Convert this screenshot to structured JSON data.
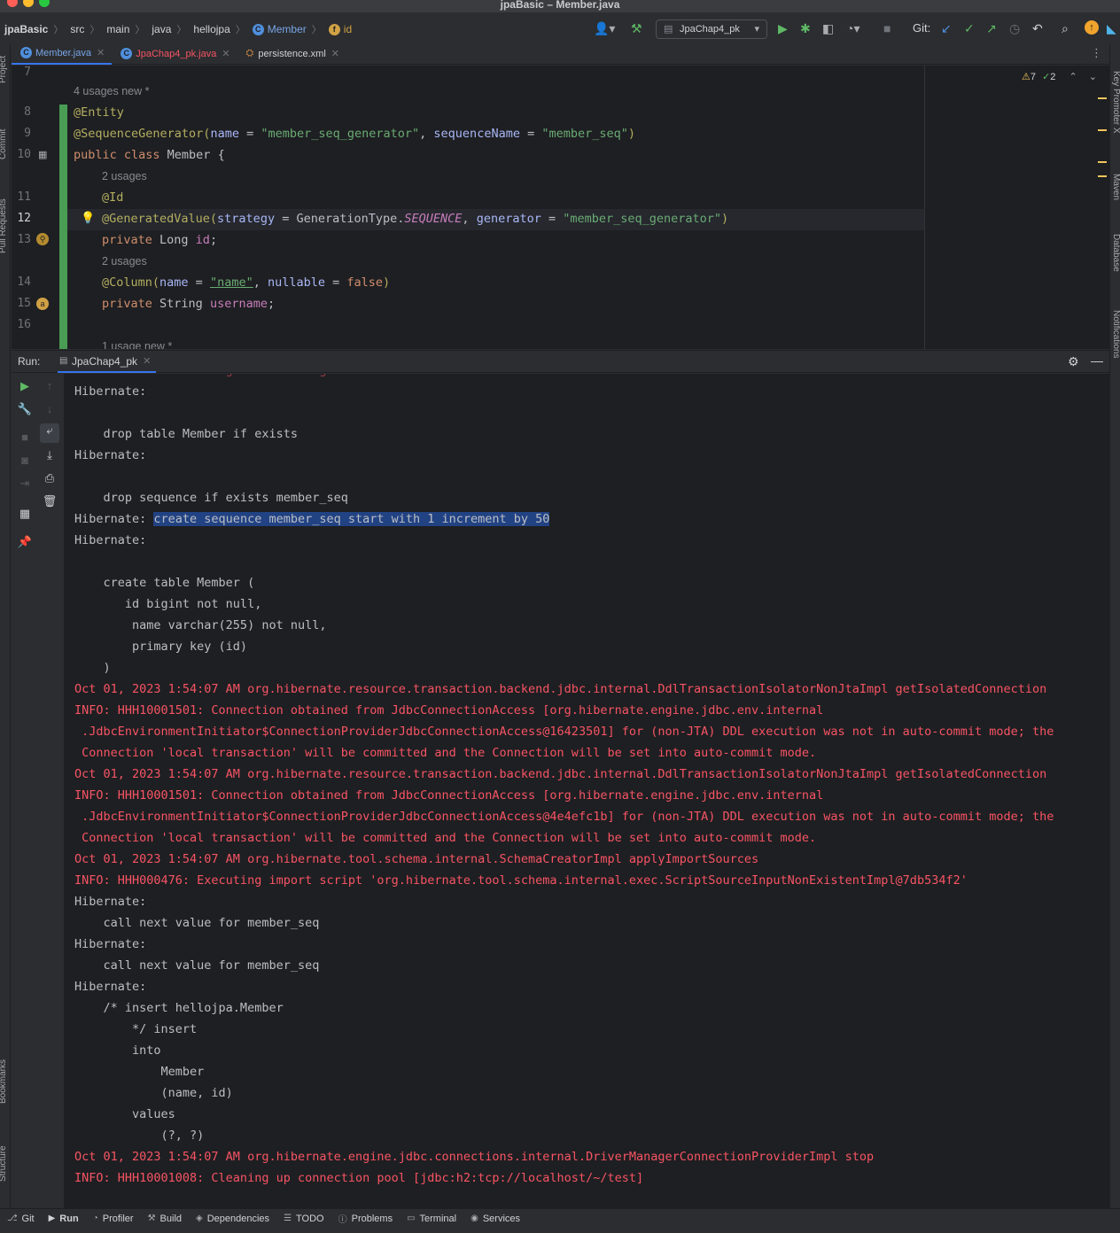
{
  "window": {
    "title": "jpaBasic – Member.java"
  },
  "breadcrumbs": [
    "jpaBasic",
    "src",
    "main",
    "java",
    "hellojpa",
    "Member",
    "id"
  ],
  "toolbar": {
    "run_config": "JpaChap4_pk",
    "git_label": "Git:"
  },
  "tabs": [
    {
      "label": "Member.java",
      "active": true,
      "color": "#7aa5e6"
    },
    {
      "label": "JpaChap4_pk.java",
      "active": false,
      "color": "#f75464"
    },
    {
      "label": "persistence.xml",
      "active": false,
      "color": "#cfd2d6"
    }
  ],
  "inspection": {
    "warnings": "7",
    "checks": "2"
  },
  "editor": {
    "hints": {
      "h1": "4 usages   new *",
      "h2": "2 usages",
      "h3": "2 usages",
      "h4": "1 usage   new *"
    },
    "line_numbers": [
      "7",
      "8",
      "9",
      "10",
      "11",
      "12",
      "13",
      "14",
      "15",
      "16"
    ],
    "lines": {
      "l8": "@Entity",
      "l9_ann": "@SequenceGenerator(",
      "l9_p1": "name",
      "l9_eq1": " = ",
      "l9_s1": "\"member_seq_generator\"",
      "l9_c": ", ",
      "l9_p2": "sequenceName",
      "l9_eq2": " = ",
      "l9_s2": "\"member_seq\"",
      "l9_end": ")",
      "l10_kw": "public class ",
      "l10_rest": "Member {",
      "l11": "@Id",
      "l12_ann": "@GeneratedValue(",
      "l12_p1": "strategy",
      "l12_eq1": " = GenerationType.",
      "l12_enum": "SEQUENCE",
      "l12_c": ", ",
      "l12_p2": "generator",
      "l12_eq2": " = ",
      "l12_s": "\"member_seq_generator\"",
      "l12_end": ")",
      "l13_kw": "private ",
      "l13_type": "Long ",
      "l13_f": "id",
      "l13_end": ";",
      "l14_ann": "@Column(",
      "l14_p1": "name",
      "l14_eq1": " = ",
      "l14_s": "\"name\"",
      "l14_c": ", ",
      "l14_p2": "nullable",
      "l14_eq2": " = ",
      "l14_kw": "false",
      "l14_end": ")",
      "l15_kw": "private ",
      "l15_type": "String ",
      "l15_f": "username",
      "l15_end": ";"
    }
  },
  "run_panel": {
    "label": "Run:",
    "tab": "JpaChap4_pk"
  },
  "console": [
    {
      "text": "Hibernate:",
      "err": false
    },
    {
      "text": "",
      "err": false
    },
    {
      "text": "    drop table Member if exists",
      "err": false
    },
    {
      "text": "Hibernate:",
      "err": false
    },
    {
      "text": "",
      "err": false
    },
    {
      "text": "    drop sequence if exists member_seq",
      "err": false
    },
    {
      "text": "Hibernate: ",
      "sel": "create sequence member_seq start with 1 increment by 50",
      "err": false
    },
    {
      "text": "Hibernate:",
      "err": false
    },
    {
      "text": "",
      "err": false
    },
    {
      "text": "    create table Member (",
      "err": false
    },
    {
      "text": "       id bigint not null,",
      "err": false
    },
    {
      "text": "        name varchar(255) not null,",
      "err": false
    },
    {
      "text": "        primary key (id)",
      "err": false
    },
    {
      "text": "    )",
      "err": false
    },
    {
      "text": "Oct 01, 2023 1:54:07 AM org.hibernate.resource.transaction.backend.jdbc.internal.DdlTransactionIsolatorNonJtaImpl getIsolatedConnection",
      "err": true
    },
    {
      "text": "INFO: HHH10001501: Connection obtained from JdbcConnectionAccess [org.hibernate.engine.jdbc.env.internal",
      "err": true
    },
    {
      "text": " .JdbcEnvironmentInitiator$ConnectionProviderJdbcConnectionAccess@16423501] for (non-JTA) DDL execution was not in auto-commit mode; the",
      "err": true
    },
    {
      "text": " Connection 'local transaction' will be committed and the Connection will be set into auto-commit mode.",
      "err": true
    },
    {
      "text": "Oct 01, 2023 1:54:07 AM org.hibernate.resource.transaction.backend.jdbc.internal.DdlTransactionIsolatorNonJtaImpl getIsolatedConnection",
      "err": true
    },
    {
      "text": "INFO: HHH10001501: Connection obtained from JdbcConnectionAccess [org.hibernate.engine.jdbc.env.internal",
      "err": true
    },
    {
      "text": " .JdbcEnvironmentInitiator$ConnectionProviderJdbcConnectionAccess@4e4efc1b] for (non-JTA) DDL execution was not in auto-commit mode; the",
      "err": true
    },
    {
      "text": " Connection 'local transaction' will be committed and the Connection will be set into auto-commit mode.",
      "err": true
    },
    {
      "text": "Oct 01, 2023 1:54:07 AM org.hibernate.tool.schema.internal.SchemaCreatorImpl applyImportSources",
      "err": true
    },
    {
      "text": "INFO: HHH000476: Executing import script 'org.hibernate.tool.schema.internal.exec.ScriptSourceInputNonExistentImpl@7db534f2'",
      "err": true
    },
    {
      "text": "Hibernate:",
      "err": false
    },
    {
      "text": "    call next value for member_seq",
      "err": false
    },
    {
      "text": "Hibernate:",
      "err": false
    },
    {
      "text": "    call next value for member_seq",
      "err": false
    },
    {
      "text": "Hibernate:",
      "err": false
    },
    {
      "text": "    /* insert hellojpa.Member",
      "err": false
    },
    {
      "text": "        */ insert",
      "err": false
    },
    {
      "text": "        into",
      "err": false
    },
    {
      "text": "            Member",
      "err": false
    },
    {
      "text": "            (name, id)",
      "err": false
    },
    {
      "text": "        values",
      "err": false
    },
    {
      "text": "            (?, ?)",
      "err": false
    },
    {
      "text": "Oct 01, 2023 1:54:07 AM org.hibernate.engine.jdbc.connections.internal.DriverManagerConnectionProviderImpl stop",
      "err": true
    },
    {
      "text": "INFO: HHH10001008: Cleaning up connection pool [jdbc:h2:tcp://localhost/~/test]",
      "err": true
    }
  ],
  "left_strip": [
    "Project",
    "Commit",
    "Pull Requests",
    "Bookmarks",
    "Structure"
  ],
  "right_strip": [
    "Key Promoter X",
    "Maven",
    "Database",
    "Notifications"
  ],
  "bottom_tabs": [
    {
      "label": "Git",
      "icon": "git-icon"
    },
    {
      "label": "Run",
      "icon": "run-icon",
      "active": true
    },
    {
      "label": "Profiler",
      "icon": "profiler-icon"
    },
    {
      "label": "Build",
      "icon": "build-icon"
    },
    {
      "label": "Dependencies",
      "icon": "dependencies-icon"
    },
    {
      "label": "TODO",
      "icon": "todo-icon"
    },
    {
      "label": "Problems",
      "icon": "problems-icon"
    },
    {
      "label": "Terminal",
      "icon": "terminal-icon"
    },
    {
      "label": "Services",
      "icon": "services-icon"
    }
  ]
}
